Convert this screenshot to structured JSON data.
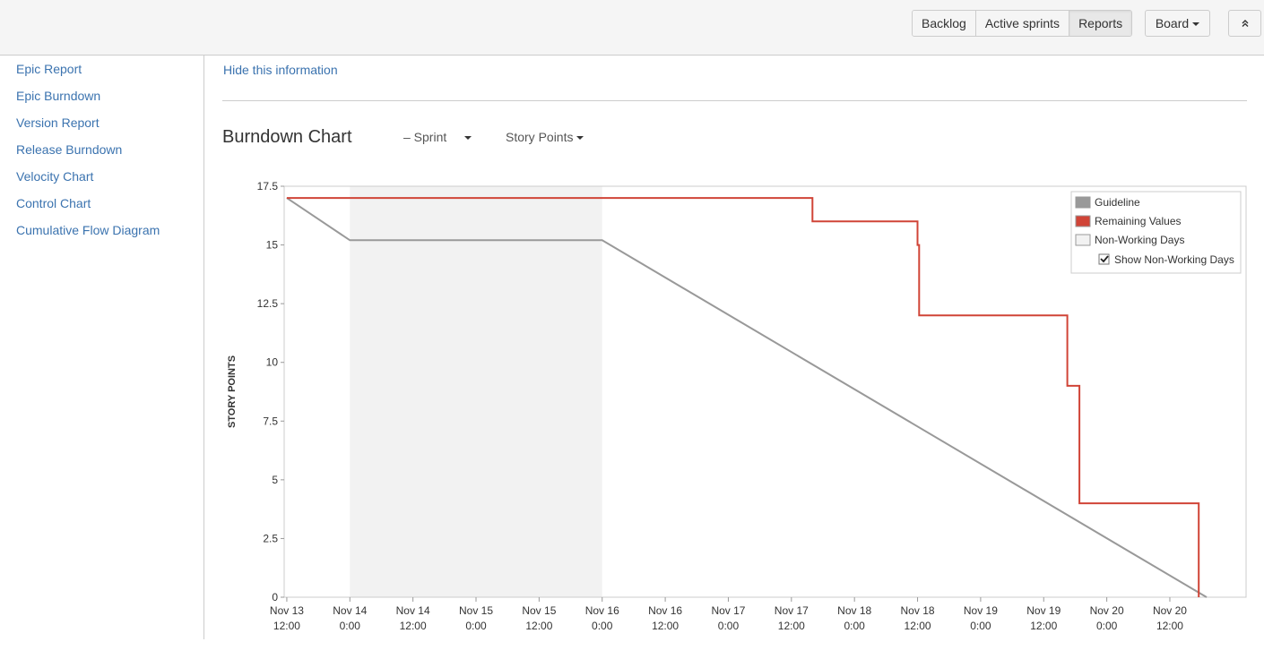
{
  "toolbar": {
    "buttons": [
      "Backlog",
      "Active sprints",
      "Reports"
    ],
    "active": "Reports",
    "board_label": "Board"
  },
  "sidebar": {
    "items": [
      {
        "label": "Epic Report"
      },
      {
        "label": "Epic Burndown"
      },
      {
        "label": "Version Report"
      },
      {
        "label": "Release Burndown"
      },
      {
        "label": "Velocity Chart"
      },
      {
        "label": "Control Chart"
      },
      {
        "label": "Cumulative Flow Diagram"
      }
    ]
  },
  "info": {
    "hide_link": "Hide this information"
  },
  "report": {
    "title": "Burndown Chart",
    "sprint_dropdown": "– Sprint",
    "estimate_dropdown": "Story Points"
  },
  "colors": {
    "accent_link": "#3b73af",
    "guideline": "#999999",
    "remaining": "#d04437",
    "non_working": "#f2f2f2"
  },
  "chart_data": {
    "type": "line",
    "title": "",
    "ylabel": "STORY POINTS",
    "xlabel": "",
    "ylim": [
      0,
      17.5
    ],
    "yticks": [
      0,
      2.5,
      5,
      7.5,
      10,
      12.5,
      15,
      17.5
    ],
    "x_unit": "hours since Nov 13 12:00",
    "xlim": [
      -0.5,
      182.5
    ],
    "xticks": [
      {
        "x": 0,
        "line1": "Nov 13",
        "line2": "12:00"
      },
      {
        "x": 12,
        "line1": "Nov 14",
        "line2": "0:00"
      },
      {
        "x": 24,
        "line1": "Nov 14",
        "line2": "12:00"
      },
      {
        "x": 36,
        "line1": "Nov 15",
        "line2": "0:00"
      },
      {
        "x": 48,
        "line1": "Nov 15",
        "line2": "12:00"
      },
      {
        "x": 60,
        "line1": "Nov 16",
        "line2": "0:00"
      },
      {
        "x": 72,
        "line1": "Nov 16",
        "line2": "12:00"
      },
      {
        "x": 84,
        "line1": "Nov 17",
        "line2": "0:00"
      },
      {
        "x": 96,
        "line1": "Nov 17",
        "line2": "12:00"
      },
      {
        "x": 108,
        "line1": "Nov 18",
        "line2": "0:00"
      },
      {
        "x": 120,
        "line1": "Nov 18",
        "line2": "12:00"
      },
      {
        "x": 132,
        "line1": "Nov 19",
        "line2": "0:00"
      },
      {
        "x": 144,
        "line1": "Nov 19",
        "line2": "12:00"
      },
      {
        "x": 156,
        "line1": "Nov 20",
        "line2": "0:00"
      },
      {
        "x": 168,
        "line1": "Nov 20",
        "line2": "12:00"
      }
    ],
    "non_working": [
      {
        "start": 12,
        "end": 60
      }
    ],
    "series": [
      {
        "name": "Guideline",
        "color": "#999999",
        "points": [
          [
            0,
            17
          ],
          [
            12,
            15.2
          ],
          [
            60,
            15.2
          ],
          [
            175,
            0
          ]
        ]
      },
      {
        "name": "Remaining Values",
        "color": "#d04437",
        "step": true,
        "points": [
          [
            0,
            17
          ],
          [
            100,
            17
          ],
          [
            100,
            16
          ],
          [
            120,
            16
          ],
          [
            120,
            15
          ],
          [
            120.3,
            15
          ],
          [
            120.3,
            12
          ],
          [
            148.5,
            12
          ],
          [
            148.5,
            9
          ],
          [
            150.8,
            9
          ],
          [
            150.8,
            4
          ],
          [
            173.5,
            4
          ],
          [
            173.5,
            0
          ]
        ]
      }
    ],
    "legend": {
      "position": "top-right",
      "entries": [
        {
          "label": "Guideline",
          "color": "#999999"
        },
        {
          "label": "Remaining Values",
          "color": "#d04437"
        },
        {
          "label": "Non-Working Days",
          "color": "#f2f2f2"
        }
      ],
      "checkbox_label": "Show Non-Working Days",
      "checkbox_checked": true
    }
  }
}
